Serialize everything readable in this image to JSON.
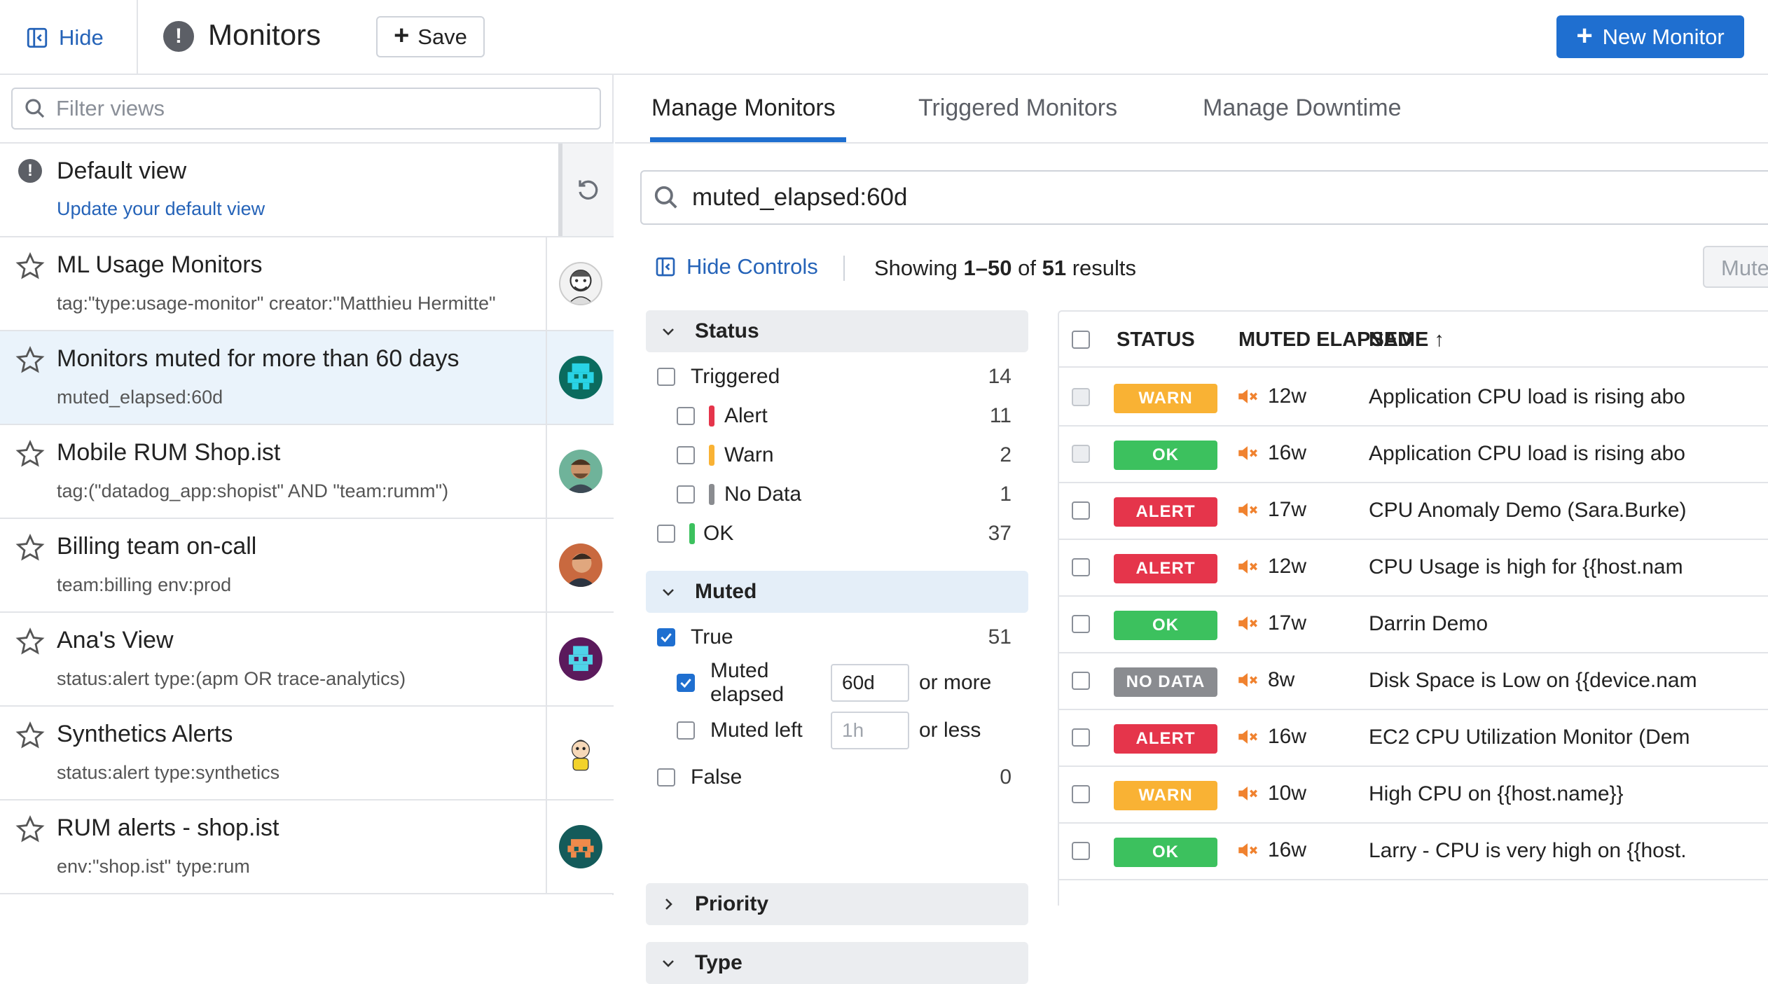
{
  "header": {
    "hide_label": "Hide",
    "title": "Monitors",
    "save_label": "Save",
    "new_monitor_label": "New Monitor"
  },
  "colors": {
    "primary": "#1f6fd0",
    "alert": "#e5354b",
    "warn": "#f9b234",
    "ok": "#3cc15e",
    "no_data": "#8a8c90",
    "muted_icon": "#f0822f"
  },
  "sidebar": {
    "filter_placeholder": "Filter views",
    "default_view": {
      "title": "Default view",
      "link": "Update your default view"
    },
    "views": [
      {
        "name": "ML Usage Monitors",
        "query": "tag:\"type:usage-monitor\" creator:\"Matthieu Hermitte\"",
        "active": false,
        "avatar": "sketch-avatar"
      },
      {
        "name": "Monitors muted for more than 60 days",
        "query": "muted_elapsed:60d",
        "active": true,
        "avatar": "pixel-avatar-cyan"
      },
      {
        "name": "Mobile RUM Shop.ist",
        "query": "tag:(\"datadog_app:shopist\" AND \"team:rumm\")",
        "active": false,
        "avatar": "photo-avatar"
      },
      {
        "name": "Billing team on-call",
        "query": "team:billing env:prod",
        "active": false,
        "avatar": "photo-avatar"
      },
      {
        "name": "Ana's View",
        "query": "status:alert type:(apm OR trace-analytics)",
        "active": false,
        "avatar": "pixel-avatar-purple"
      },
      {
        "name": "Synthetics Alerts",
        "query": "status:alert type:synthetics",
        "active": false,
        "avatar": "cartoon-avatar"
      },
      {
        "name": "RUM alerts - shop.ist",
        "query": "env:\"shop.ist\" type:rum",
        "active": false,
        "avatar": "pixel-avatar-teal"
      }
    ]
  },
  "main": {
    "tabs": [
      {
        "label": "Manage Monitors",
        "active": true
      },
      {
        "label": "Triggered Monitors",
        "active": false
      },
      {
        "label": "Manage Downtime",
        "active": false
      }
    ],
    "search_value": "muted_elapsed:60d",
    "hide_controls_label": "Hide Controls",
    "showing": {
      "prefix": "Showing ",
      "range": "1–50",
      "of": " of ",
      "total": "51",
      "suffix": " results"
    },
    "mute_label": "Mute"
  },
  "facets": {
    "status": {
      "title": "Status",
      "triggered": {
        "label": "Triggered",
        "count": "14"
      },
      "alert": {
        "label": "Alert",
        "count": "11"
      },
      "warn": {
        "label": "Warn",
        "count": "2"
      },
      "no_data": {
        "label": "No Data",
        "count": "1"
      },
      "ok": {
        "label": "OK",
        "count": "37"
      }
    },
    "muted": {
      "title": "Muted",
      "true": {
        "label": "True",
        "count": "51"
      },
      "muted_elapsed": {
        "label": "Muted elapsed",
        "value": "60d",
        "suffix": "or more"
      },
      "muted_left": {
        "label": "Muted left",
        "placeholder": "1h",
        "suffix": "or less"
      },
      "false": {
        "label": "False",
        "count": "0"
      }
    },
    "priority": {
      "title": "Priority"
    },
    "type": {
      "title": "Type"
    }
  },
  "table": {
    "columns": {
      "status": "STATUS",
      "muted_elapsed": "MUTED ELAPSED",
      "name": "NAME ↑"
    },
    "rows": [
      {
        "status": "WARN",
        "muted": "12w",
        "name": "Application CPU load is rising abo"
      },
      {
        "status": "OK",
        "muted": "16w",
        "name": "Application CPU load is rising abo"
      },
      {
        "status": "ALERT",
        "muted": "17w",
        "name": "CPU Anomaly Demo (Sara.Burke)"
      },
      {
        "status": "ALERT",
        "muted": "12w",
        "name": "CPU Usage is high for {{host.nam"
      },
      {
        "status": "OK",
        "muted": "17w",
        "name": "Darrin Demo"
      },
      {
        "status": "NO DATA",
        "muted": "8w",
        "name": "Disk Space is Low on {{device.nam"
      },
      {
        "status": "ALERT",
        "muted": "16w",
        "name": "EC2 CPU Utilization Monitor (Dem"
      },
      {
        "status": "WARN",
        "muted": "10w",
        "name": "High CPU on {{host.name}}"
      },
      {
        "status": "OK",
        "muted": "16w",
        "name": "Larry - CPU is very high on {{host."
      }
    ]
  }
}
